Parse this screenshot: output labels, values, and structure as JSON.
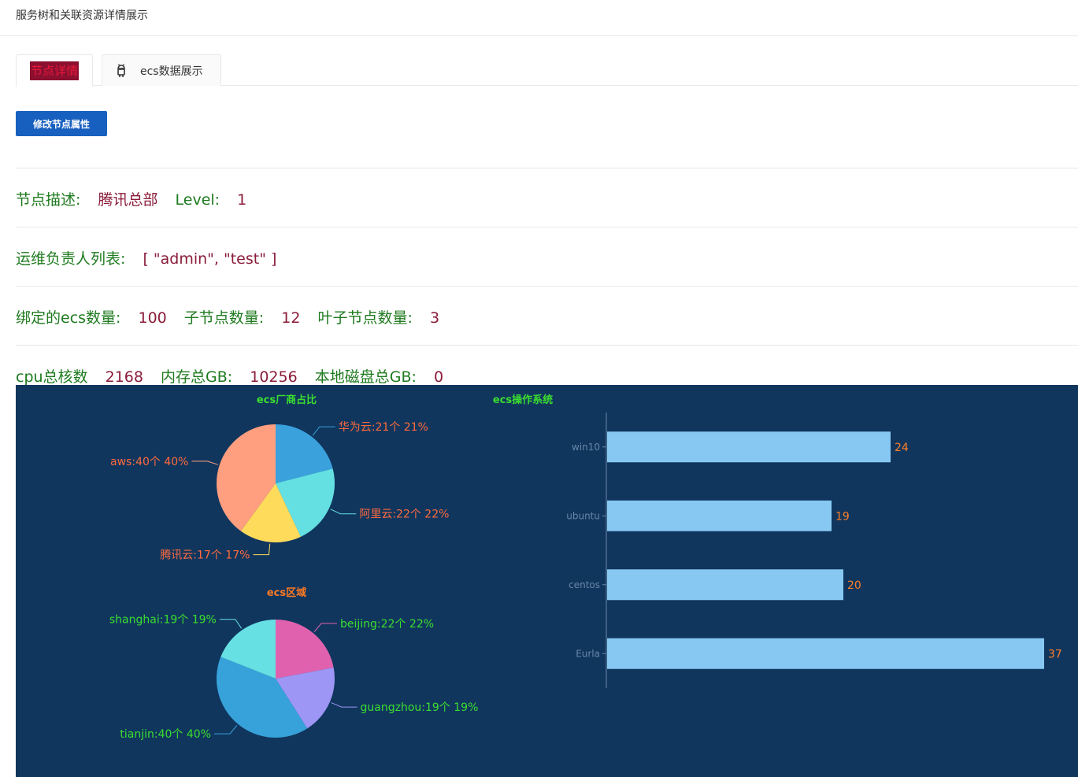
{
  "header": {
    "title": "服务树和关联资源详情展示"
  },
  "tabs": [
    {
      "label": "节点详情",
      "active": true
    },
    {
      "label": "ecs数据展示",
      "icon": "android-icon",
      "active": false
    }
  ],
  "actions": {
    "edit_button": "修改节点属性"
  },
  "node": {
    "desc_label": "节点描述:",
    "desc_value": "腾讯总部",
    "level_label": "Level:",
    "level_value": "1",
    "owners_label": "运维负责人列表:",
    "owners_value": "[ \"admin\", \"test\" ]",
    "ecs_count_label": "绑定的ecs数量:",
    "ecs_count_value": "100",
    "children_label": "子节点数量:",
    "children_value": "12",
    "leaf_label": "叶子节点数量:",
    "leaf_value": "3",
    "cpu_label": "cpu总核数",
    "cpu_value": "2168",
    "mem_label": "内存总GB:",
    "mem_value": "10256",
    "disk_label": "本地磁盘总GB:",
    "disk_value": "0"
  },
  "colors": {
    "panel_bg": "#10365e",
    "label_green": "#1e7a1e",
    "value_red": "#8a1c3a",
    "bar_fill": "#87c8f2",
    "bar_label": "#ff7f27",
    "axis_text": "#6a86a8"
  },
  "chart_data": [
    {
      "type": "pie",
      "title": "ecs厂商占比",
      "title_color": "#3bde2e",
      "label_color": "#ff6a3d",
      "slices": [
        {
          "name": "华为云",
          "value": 21,
          "percent": 21,
          "label": "华为云:21个 21%",
          "color": "#3aa1dc"
        },
        {
          "name": "阿里云",
          "value": 22,
          "percent": 22,
          "label": "阿里云:22个 22%",
          "color": "#64e0e3"
        },
        {
          "name": "腾讯云",
          "value": 17,
          "percent": 17,
          "label": "腾讯云:17个 17%",
          "color": "#ffdb5c"
        },
        {
          "name": "aws",
          "value": 40,
          "percent": 40,
          "label": "aws:40个 40%",
          "color": "#ff9f7f"
        }
      ]
    },
    {
      "type": "pie",
      "title": "ecs区域",
      "title_color": "#ff7a22",
      "label_color": "#3bde2e",
      "slices": [
        {
          "name": "beijing",
          "value": 22,
          "percent": 22,
          "label": "beijing:22个 22%",
          "color": "#e062ae"
        },
        {
          "name": "guangzhou",
          "value": 19,
          "percent": 19,
          "label": "guangzhou:19个 19%",
          "color": "#9d96f5"
        },
        {
          "name": "tianjin",
          "value": 40,
          "percent": 40,
          "label": "tianjin:40个 40%",
          "color": "#37a2da"
        },
        {
          "name": "shanghai",
          "value": 19,
          "percent": 19,
          "label": "shanghai:19个 19%",
          "color": "#67e0e3"
        }
      ]
    },
    {
      "type": "bar",
      "orientation": "horizontal",
      "title": "ecs操作系统",
      "title_color": "#3bde2e",
      "categories": [
        "win10",
        "ubuntu",
        "centos",
        "Eurla"
      ],
      "values": [
        24,
        19,
        20,
        37
      ],
      "xlim": [
        0,
        37
      ]
    }
  ]
}
